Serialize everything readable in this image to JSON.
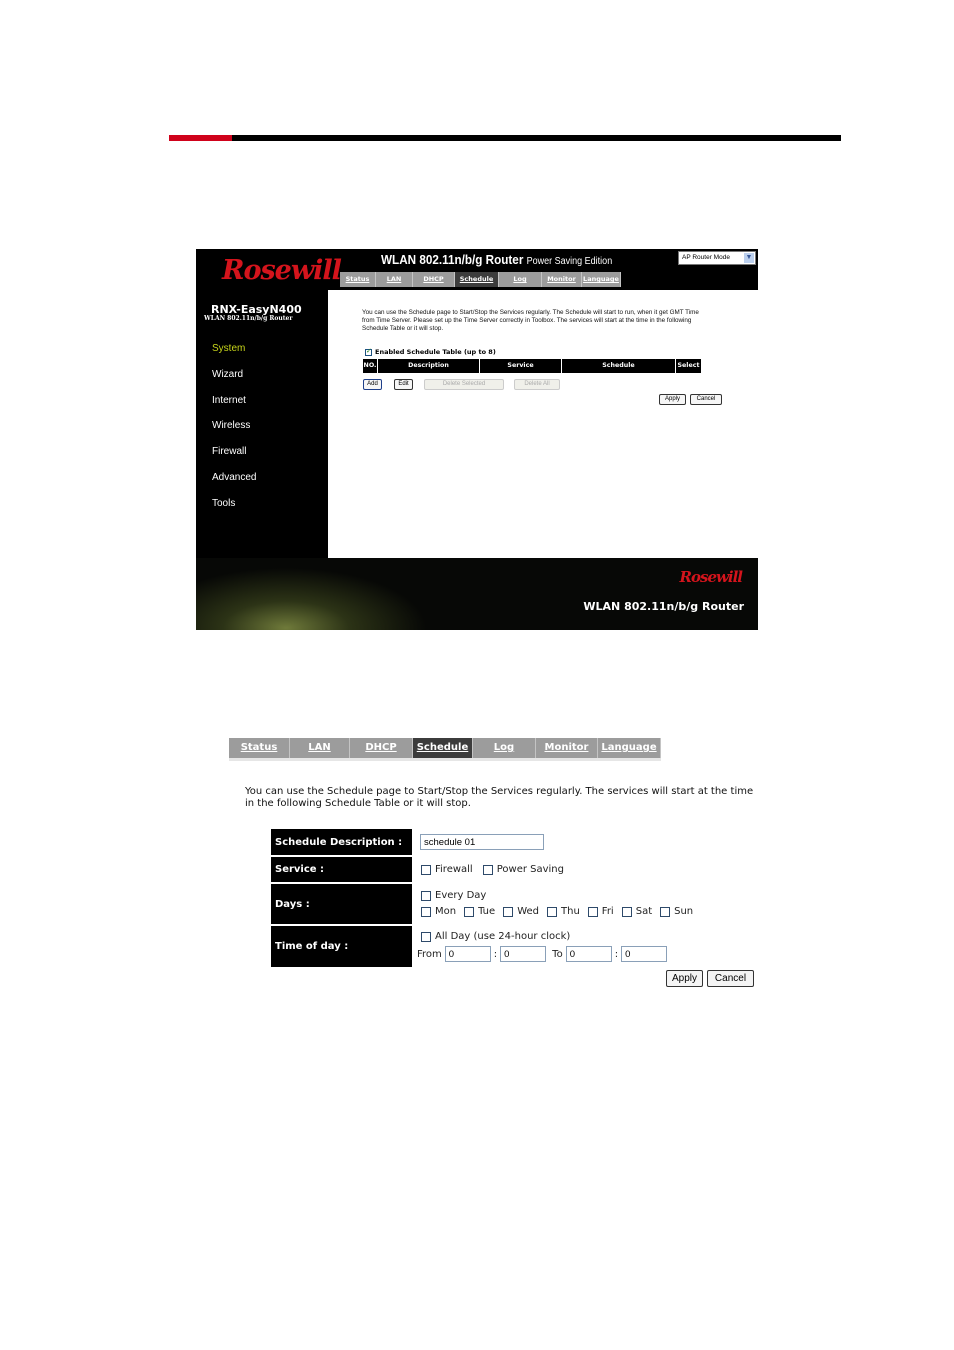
{
  "header_rule": {
    "accent": "#d0021b",
    "base": "#000000"
  },
  "screenshot1": {
    "brand": "Rosewill",
    "model": "RNX-EasyN400",
    "model_sub": "WLAN 802.11n/b/g Router",
    "title_main": "WLAN 802.11n/b/g Router",
    "title_edition": "Power Saving Edition",
    "mode_select": "AP Router Mode",
    "sidebar": [
      "System",
      "Wizard",
      "Internet",
      "Wireless",
      "Firewall",
      "Advanced",
      "Tools"
    ],
    "sidebar_active": "System",
    "tabs": [
      "Status",
      "LAN",
      "DHCP",
      "Schedule",
      "Log",
      "Monitor",
      "Language"
    ],
    "active_tab": "Schedule",
    "intro": "You can use the Schedule page to Start/Stop the Services regularly. The Schedule will start to run, when it get GMT Time from Time Server. Please set up the Time Server correctly in Toolbox. The services will start at the time in the following Schedule Table or it will stop.",
    "enable_label": "Enabled Schedule Table (up to 8)",
    "enable_checked": true,
    "table_headers": [
      "NO.",
      "Description",
      "Service",
      "Schedule",
      "Select"
    ],
    "buttons": {
      "add": "Add",
      "edit": "Edit",
      "delete_selected": "Delete Selected",
      "delete_all": "Delete All",
      "apply": "Apply",
      "cancel": "Cancel"
    },
    "footer_brand": "Rosewill",
    "footer_title": "WLAN 802.11n/b/g Router"
  },
  "screenshot2": {
    "tabs": [
      "Status",
      "LAN",
      "DHCP",
      "Schedule",
      "Log",
      "Monitor",
      "Language"
    ],
    "active_tab": "Schedule",
    "intro": "You can use the Schedule page to Start/Stop the Services regularly. The services will start at the time in the following Schedule Table or it will stop.",
    "labels": {
      "description": "Schedule Description :",
      "service": "Service :",
      "days": "Days :",
      "time": "Time of day :"
    },
    "description_value": "schedule 01",
    "services": [
      "Firewall",
      "Power Saving"
    ],
    "every_day": "Every Day",
    "days": [
      "Mon",
      "Tue",
      "Wed",
      "Thu",
      "Fri",
      "Sat",
      "Sun"
    ],
    "all_day": "All Day (use 24-hour clock)",
    "from_label": "From",
    "to_label": "To",
    "colon": ":",
    "from_hour": "0",
    "from_min": "0",
    "to_hour": "0",
    "to_min": "0",
    "buttons": {
      "apply": "Apply",
      "cancel": "Cancel"
    }
  }
}
